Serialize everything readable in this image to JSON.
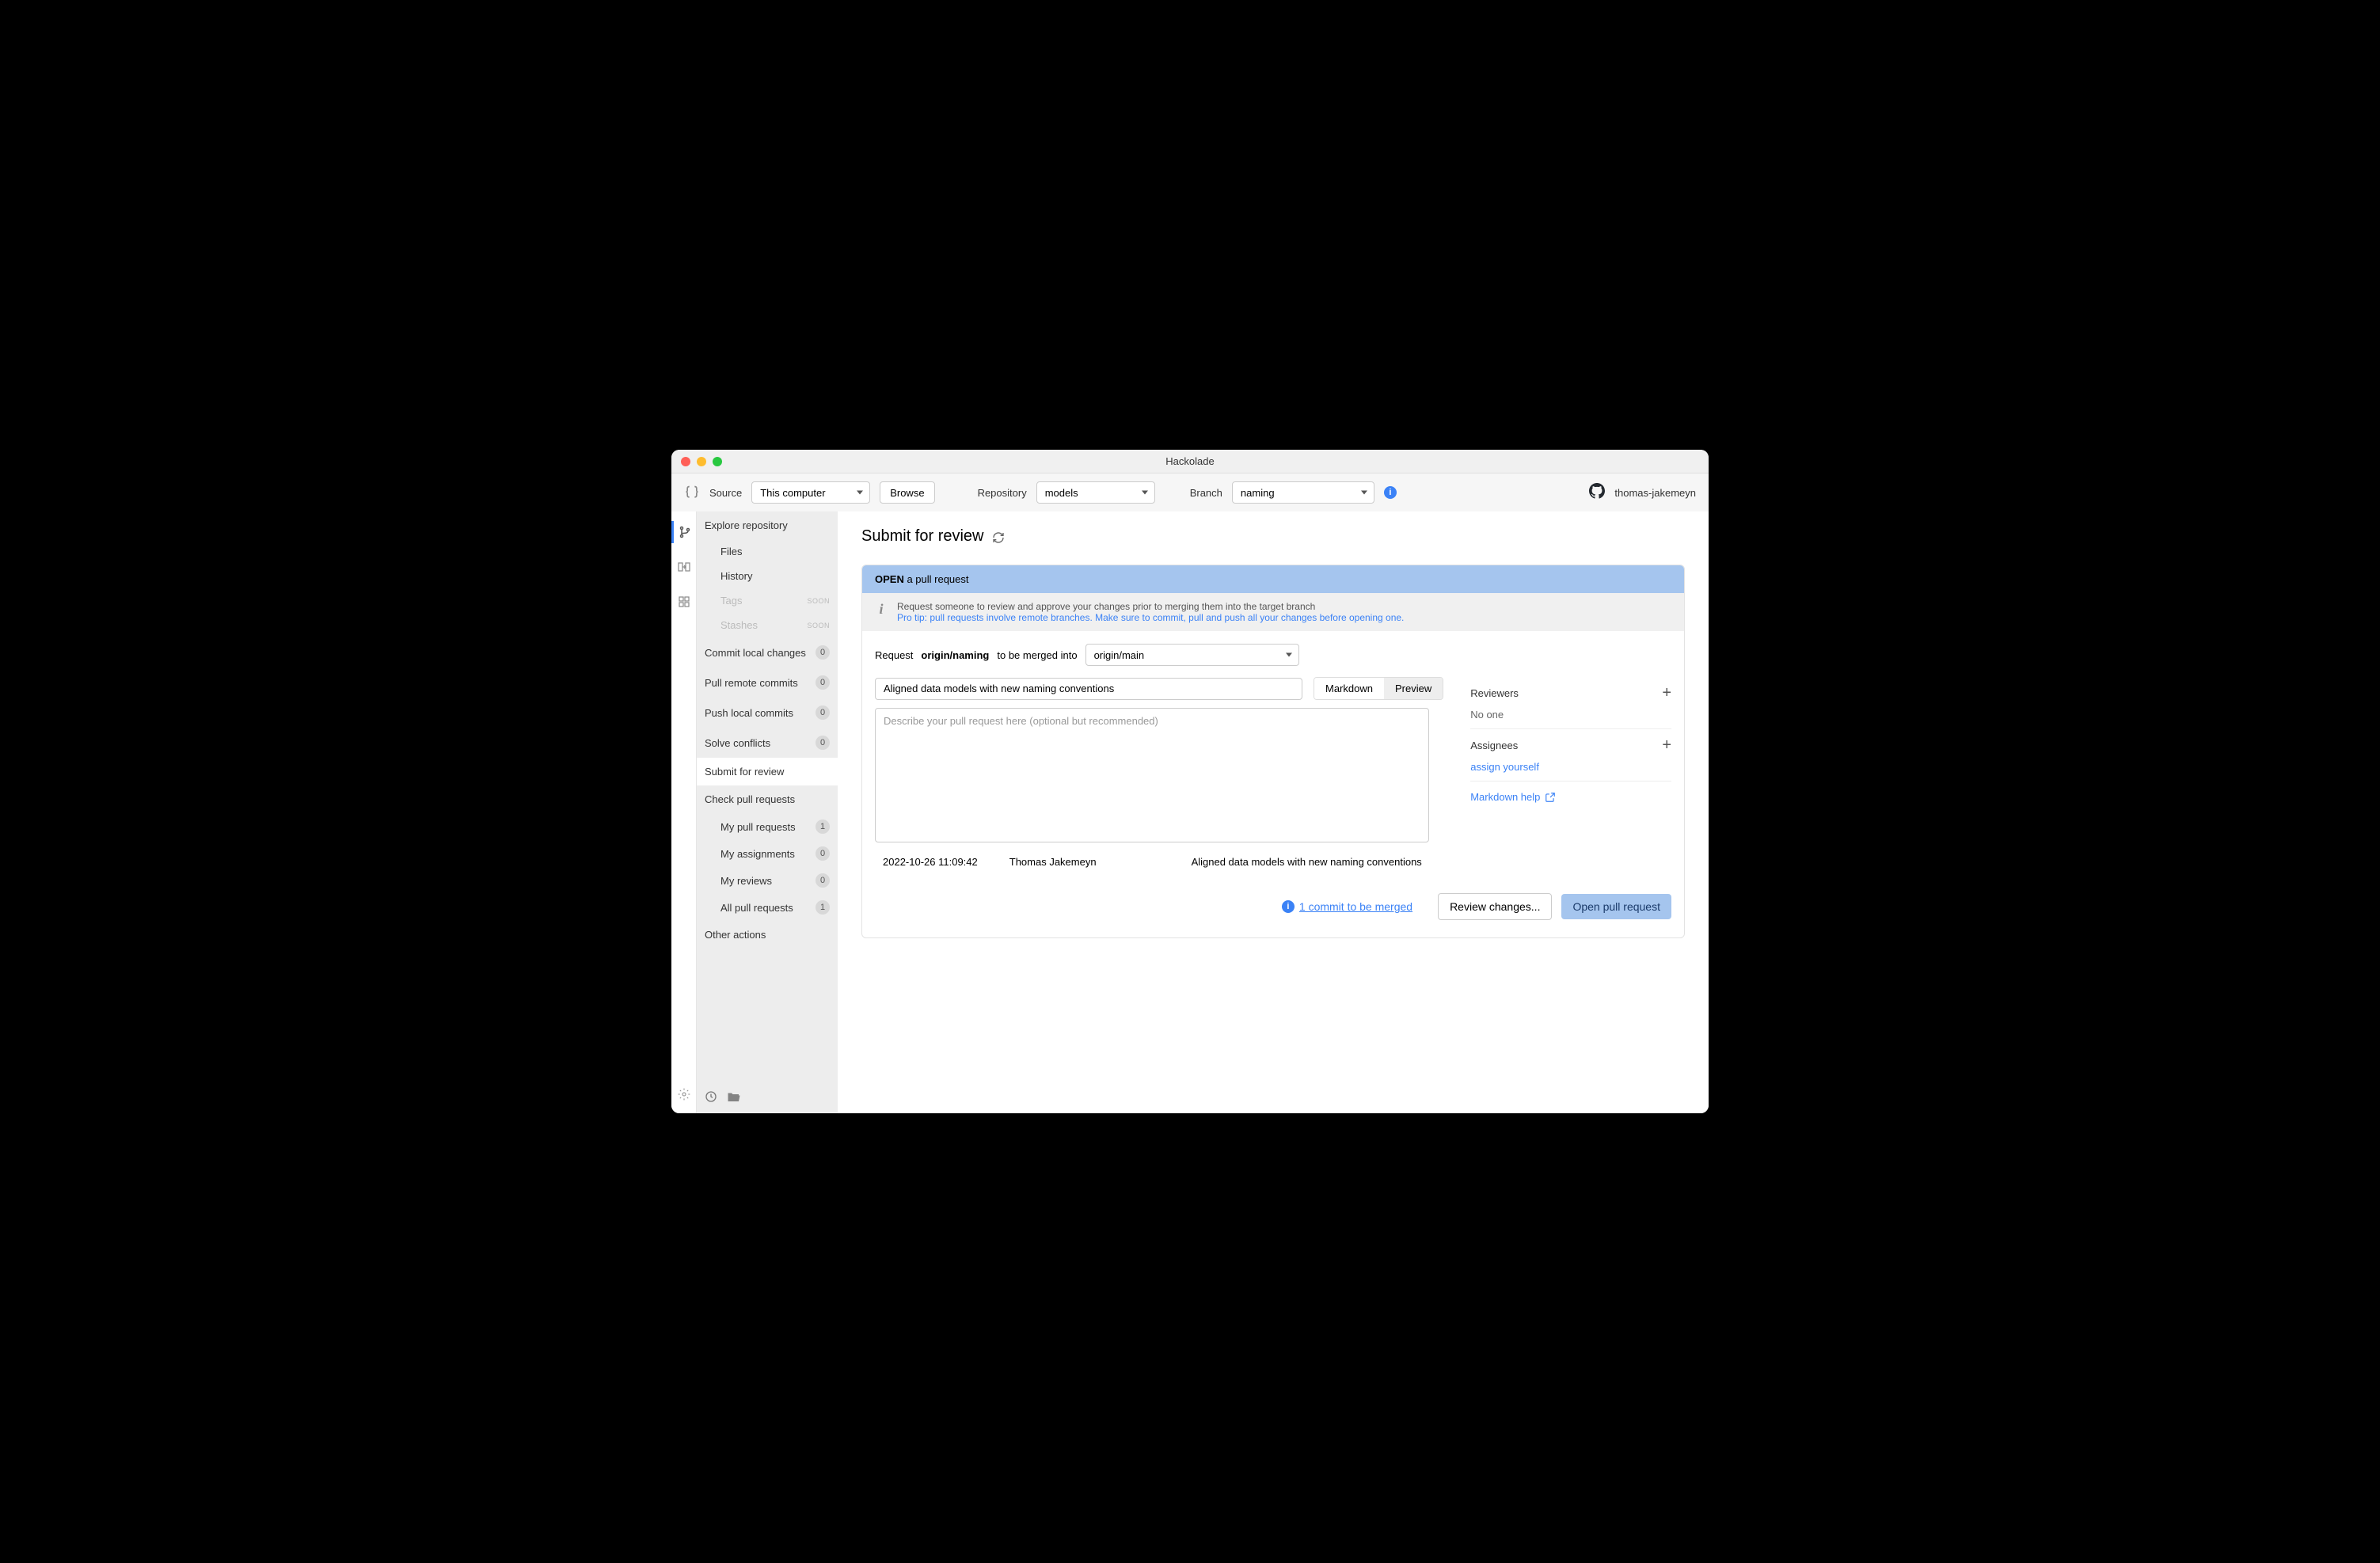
{
  "title": "Hackolade",
  "topbar": {
    "source_label": "Source",
    "source_value": "This computer",
    "browse": "Browse",
    "repo_label": "Repository",
    "repo_value": "models",
    "branch_label": "Branch",
    "branch_value": "naming",
    "user": "thomas-jakemeyn"
  },
  "sidebar": {
    "explore": "Explore repository",
    "files": "Files",
    "history": "History",
    "tags": "Tags",
    "stashes": "Stashes",
    "soon": "SOON",
    "commit": "Commit local changes",
    "commit_count": "0",
    "pull": "Pull remote commits",
    "pull_count": "0",
    "push": "Push local commits",
    "push_count": "0",
    "solve": "Solve conflicts",
    "solve_count": "0",
    "submit": "Submit for review",
    "check": "Check pull requests",
    "my_prs": "My pull requests",
    "my_prs_count": "1",
    "my_assign": "My assignments",
    "my_assign_count": "0",
    "my_reviews": "My reviews",
    "my_reviews_count": "0",
    "all_prs": "All pull requests",
    "all_prs_count": "1",
    "other": "Other actions"
  },
  "page": {
    "heading": "Submit for review",
    "banner_open": "OPEN",
    "banner_rest": " a pull request",
    "info1": "Request someone to review and approve your changes prior to merging them into the target branch",
    "info2_prefix": "Pro tip: ",
    "info2_link": "pull requests involve remote branches. Make sure to commit, pull and push all your changes before opening one.",
    "merge_prefix": "Request ",
    "merge_branch": "origin/naming",
    "merge_mid": " to be merged into",
    "merge_target": "origin/main",
    "pr_title": "Aligned data models with new naming conventions",
    "desc_placeholder": "Describe your pull request here (optional but recommended)",
    "tab_md": "Markdown",
    "tab_preview": "Preview",
    "reviewers": "Reviewers",
    "reviewers_none": "No one",
    "assignees": "Assignees",
    "assign_self": "assign yourself",
    "md_help": "Markdown help",
    "commit_date": "2022-10-26 11:09:42",
    "commit_author": "Thomas Jakemeyn",
    "commit_msg": "Aligned data models with new naming conventions",
    "commits_link": "1 commit to be merged",
    "review_btn": "Review changes...",
    "open_btn": "Open pull request"
  }
}
